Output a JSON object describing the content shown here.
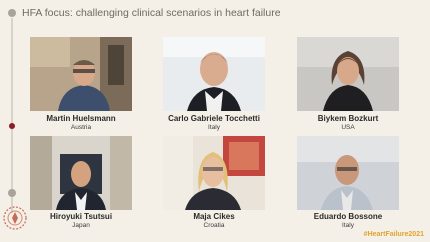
{
  "header": {
    "title": "HFA focus: challenging clinical scenarios in heart failure"
  },
  "participants": [
    {
      "name": "Martin Huelsmann",
      "country": "Austria"
    },
    {
      "name": "Carlo Gabriele Tocchetti",
      "country": "Italy"
    },
    {
      "name": "Biykem Bozkurt",
      "country": "USA"
    },
    {
      "name": "Hiroyuki Tsutsui",
      "country": "Japan"
    },
    {
      "name": "Maja Cikes",
      "country": "Croatia"
    },
    {
      "name": "Eduardo Bossone",
      "country": "Italy"
    }
  ],
  "footer": {
    "hashtag": "#HeartFailure2021"
  },
  "colors": {
    "background": "#f4efe7",
    "accent": "#8b1d2a",
    "hashtag": "#e1a42f"
  }
}
